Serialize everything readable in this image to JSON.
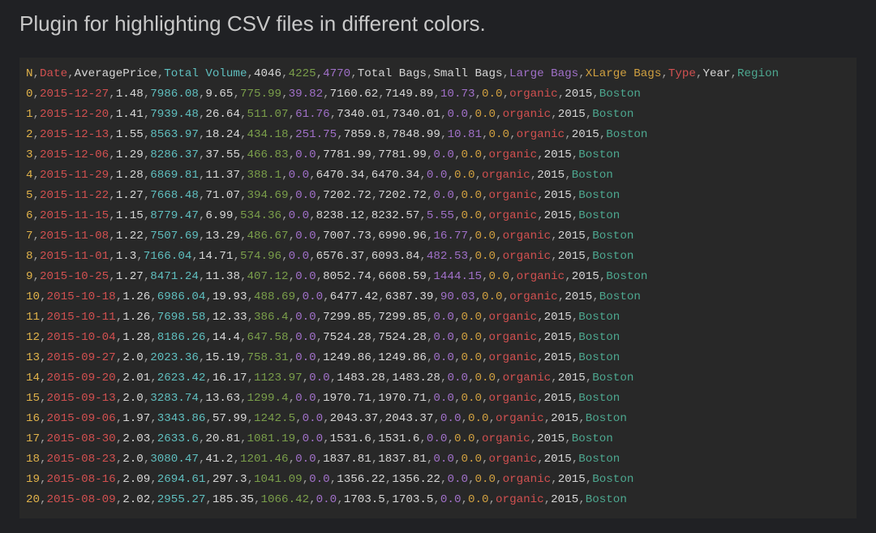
{
  "title": "Plugin for highlighting CSV files in different colors.",
  "chart_data": {
    "type": "table",
    "columns": [
      "N",
      "Date",
      "AveragePrice",
      "Total Volume",
      "4046",
      "4225",
      "4770",
      "Total Bags",
      "Small Bags",
      "Large Bags",
      "XLarge Bags",
      "Type",
      "Year",
      "Region"
    ],
    "rows": [
      [
        "0",
        "2015-12-27",
        "1.48",
        "7986.08",
        "9.65",
        "775.99",
        "39.82",
        "7160.62",
        "7149.89",
        "10.73",
        "0.0",
        "organic",
        "2015",
        "Boston"
      ],
      [
        "1",
        "2015-12-20",
        "1.41",
        "7939.48",
        "26.64",
        "511.07",
        "61.76",
        "7340.01",
        "7340.01",
        "0.0",
        "0.0",
        "organic",
        "2015",
        "Boston"
      ],
      [
        "2",
        "2015-12-13",
        "1.55",
        "8563.97",
        "18.24",
        "434.18",
        "251.75",
        "7859.8",
        "7848.99",
        "10.81",
        "0.0",
        "organic",
        "2015",
        "Boston"
      ],
      [
        "3",
        "2015-12-06",
        "1.29",
        "8286.37",
        "37.55",
        "466.83",
        "0.0",
        "7781.99",
        "7781.99",
        "0.0",
        "0.0",
        "organic",
        "2015",
        "Boston"
      ],
      [
        "4",
        "2015-11-29",
        "1.28",
        "6869.81",
        "11.37",
        "388.1",
        "0.0",
        "6470.34",
        "6470.34",
        "0.0",
        "0.0",
        "organic",
        "2015",
        "Boston"
      ],
      [
        "5",
        "2015-11-22",
        "1.27",
        "7668.48",
        "71.07",
        "394.69",
        "0.0",
        "7202.72",
        "7202.72",
        "0.0",
        "0.0",
        "organic",
        "2015",
        "Boston"
      ],
      [
        "6",
        "2015-11-15",
        "1.15",
        "8779.47",
        "6.99",
        "534.36",
        "0.0",
        "8238.12",
        "8232.57",
        "5.55",
        "0.0",
        "organic",
        "2015",
        "Boston"
      ],
      [
        "7",
        "2015-11-08",
        "1.22",
        "7507.69",
        "13.29",
        "486.67",
        "0.0",
        "7007.73",
        "6990.96",
        "16.77",
        "0.0",
        "organic",
        "2015",
        "Boston"
      ],
      [
        "8",
        "2015-11-01",
        "1.3",
        "7166.04",
        "14.71",
        "574.96",
        "0.0",
        "6576.37",
        "6093.84",
        "482.53",
        "0.0",
        "organic",
        "2015",
        "Boston"
      ],
      [
        "9",
        "2015-10-25",
        "1.27",
        "8471.24",
        "11.38",
        "407.12",
        "0.0",
        "8052.74",
        "6608.59",
        "1444.15",
        "0.0",
        "organic",
        "2015",
        "Boston"
      ],
      [
        "10",
        "2015-10-18",
        "1.26",
        "6986.04",
        "19.93",
        "488.69",
        "0.0",
        "6477.42",
        "6387.39",
        "90.03",
        "0.0",
        "organic",
        "2015",
        "Boston"
      ],
      [
        "11",
        "2015-10-11",
        "1.26",
        "7698.58",
        "12.33",
        "386.4",
        "0.0",
        "7299.85",
        "7299.85",
        "0.0",
        "0.0",
        "organic",
        "2015",
        "Boston"
      ],
      [
        "12",
        "2015-10-04",
        "1.28",
        "8186.26",
        "14.4",
        "647.58",
        "0.0",
        "7524.28",
        "7524.28",
        "0.0",
        "0.0",
        "organic",
        "2015",
        "Boston"
      ],
      [
        "13",
        "2015-09-27",
        "2.0",
        "2023.36",
        "15.19",
        "758.31",
        "0.0",
        "1249.86",
        "1249.86",
        "0.0",
        "0.0",
        "organic",
        "2015",
        "Boston"
      ],
      [
        "14",
        "2015-09-20",
        "2.01",
        "2623.42",
        "16.17",
        "1123.97",
        "0.0",
        "1483.28",
        "1483.28",
        "0.0",
        "0.0",
        "organic",
        "2015",
        "Boston"
      ],
      [
        "15",
        "2015-09-13",
        "2.0",
        "3283.74",
        "13.63",
        "1299.4",
        "0.0",
        "1970.71",
        "1970.71",
        "0.0",
        "0.0",
        "organic",
        "2015",
        "Boston"
      ],
      [
        "16",
        "2015-09-06",
        "1.97",
        "3343.86",
        "57.99",
        "1242.5",
        "0.0",
        "2043.37",
        "2043.37",
        "0.0",
        "0.0",
        "organic",
        "2015",
        "Boston"
      ],
      [
        "17",
        "2015-08-30",
        "2.03",
        "2633.6",
        "20.81",
        "1081.19",
        "0.0",
        "1531.6",
        "1531.6",
        "0.0",
        "0.0",
        "organic",
        "2015",
        "Boston"
      ],
      [
        "18",
        "2015-08-23",
        "2.0",
        "3080.47",
        "41.2",
        "1201.46",
        "0.0",
        "1837.81",
        "1837.81",
        "0.0",
        "0.0",
        "organic",
        "2015",
        "Boston"
      ],
      [
        "19",
        "2015-08-16",
        "2.09",
        "2694.61",
        "297.3",
        "1041.09",
        "0.0",
        "1356.22",
        "1356.22",
        "0.0",
        "0.0",
        "organic",
        "2015",
        "Boston"
      ],
      [
        "20",
        "2015-08-09",
        "2.02",
        "2955.27",
        "185.35",
        "1066.42",
        "0.0",
        "1703.5",
        "1703.5",
        "0.0",
        "0.0",
        "organic",
        "2015",
        "Boston"
      ]
    ]
  }
}
